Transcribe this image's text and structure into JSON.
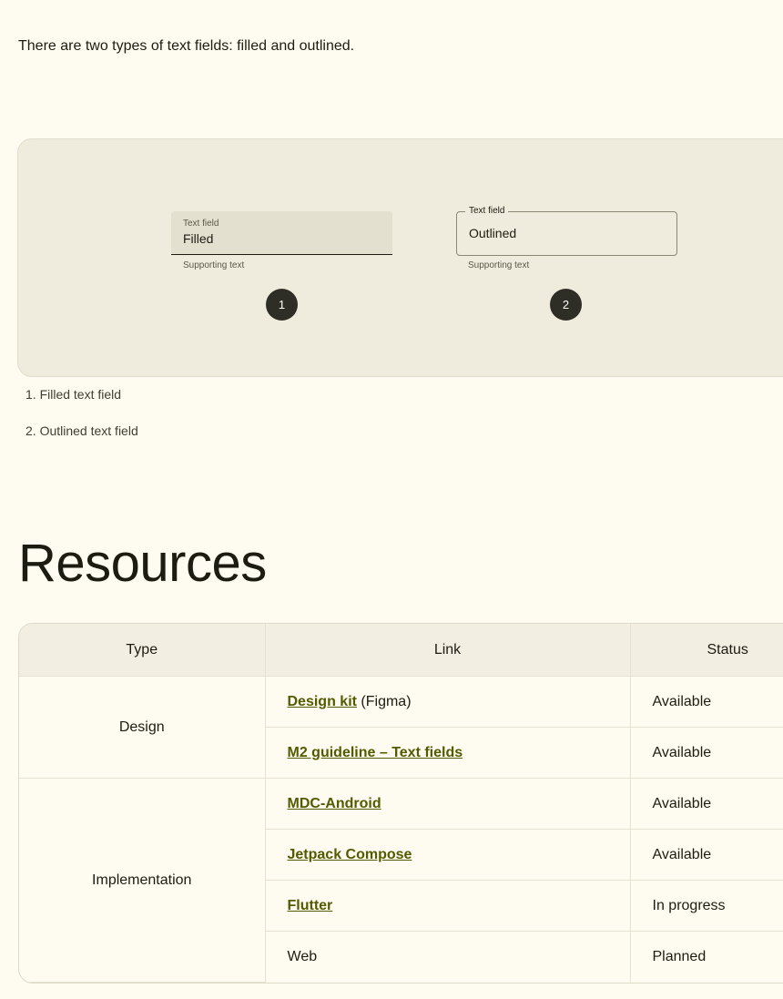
{
  "intro": "There are two types of text fields: filled and outlined.",
  "demo": {
    "filled": {
      "label": "Text field",
      "value": "Filled",
      "supporting": "Supporting text",
      "badge": "1"
    },
    "outlined": {
      "label": "Text field",
      "value": "Outlined",
      "supporting": "Supporting text",
      "badge": "2"
    }
  },
  "captions": [
    "1. Filled text field",
    "2. Outlined text field"
  ],
  "resources": {
    "title": "Resources",
    "headers": [
      "Type",
      "Link",
      "Status"
    ],
    "groups": [
      {
        "type": "Design",
        "rows": [
          {
            "link": "Design kit",
            "note": " (Figma)",
            "status": "Available"
          },
          {
            "link": "M2 guideline – Text fields",
            "status": "Available"
          }
        ]
      },
      {
        "type": "Implementation",
        "rows": [
          {
            "link": "MDC-Android",
            "status": "Available"
          },
          {
            "link": "Jetpack Compose",
            "status": "Available"
          },
          {
            "link": "Flutter",
            "status": "In progress"
          },
          {
            "text": "Web",
            "status": "Planned"
          }
        ]
      }
    ]
  },
  "colors": {
    "background": "#fefbf0",
    "panel": "#efebdd",
    "link": "#535a00",
    "badge": "#2f2e26"
  }
}
